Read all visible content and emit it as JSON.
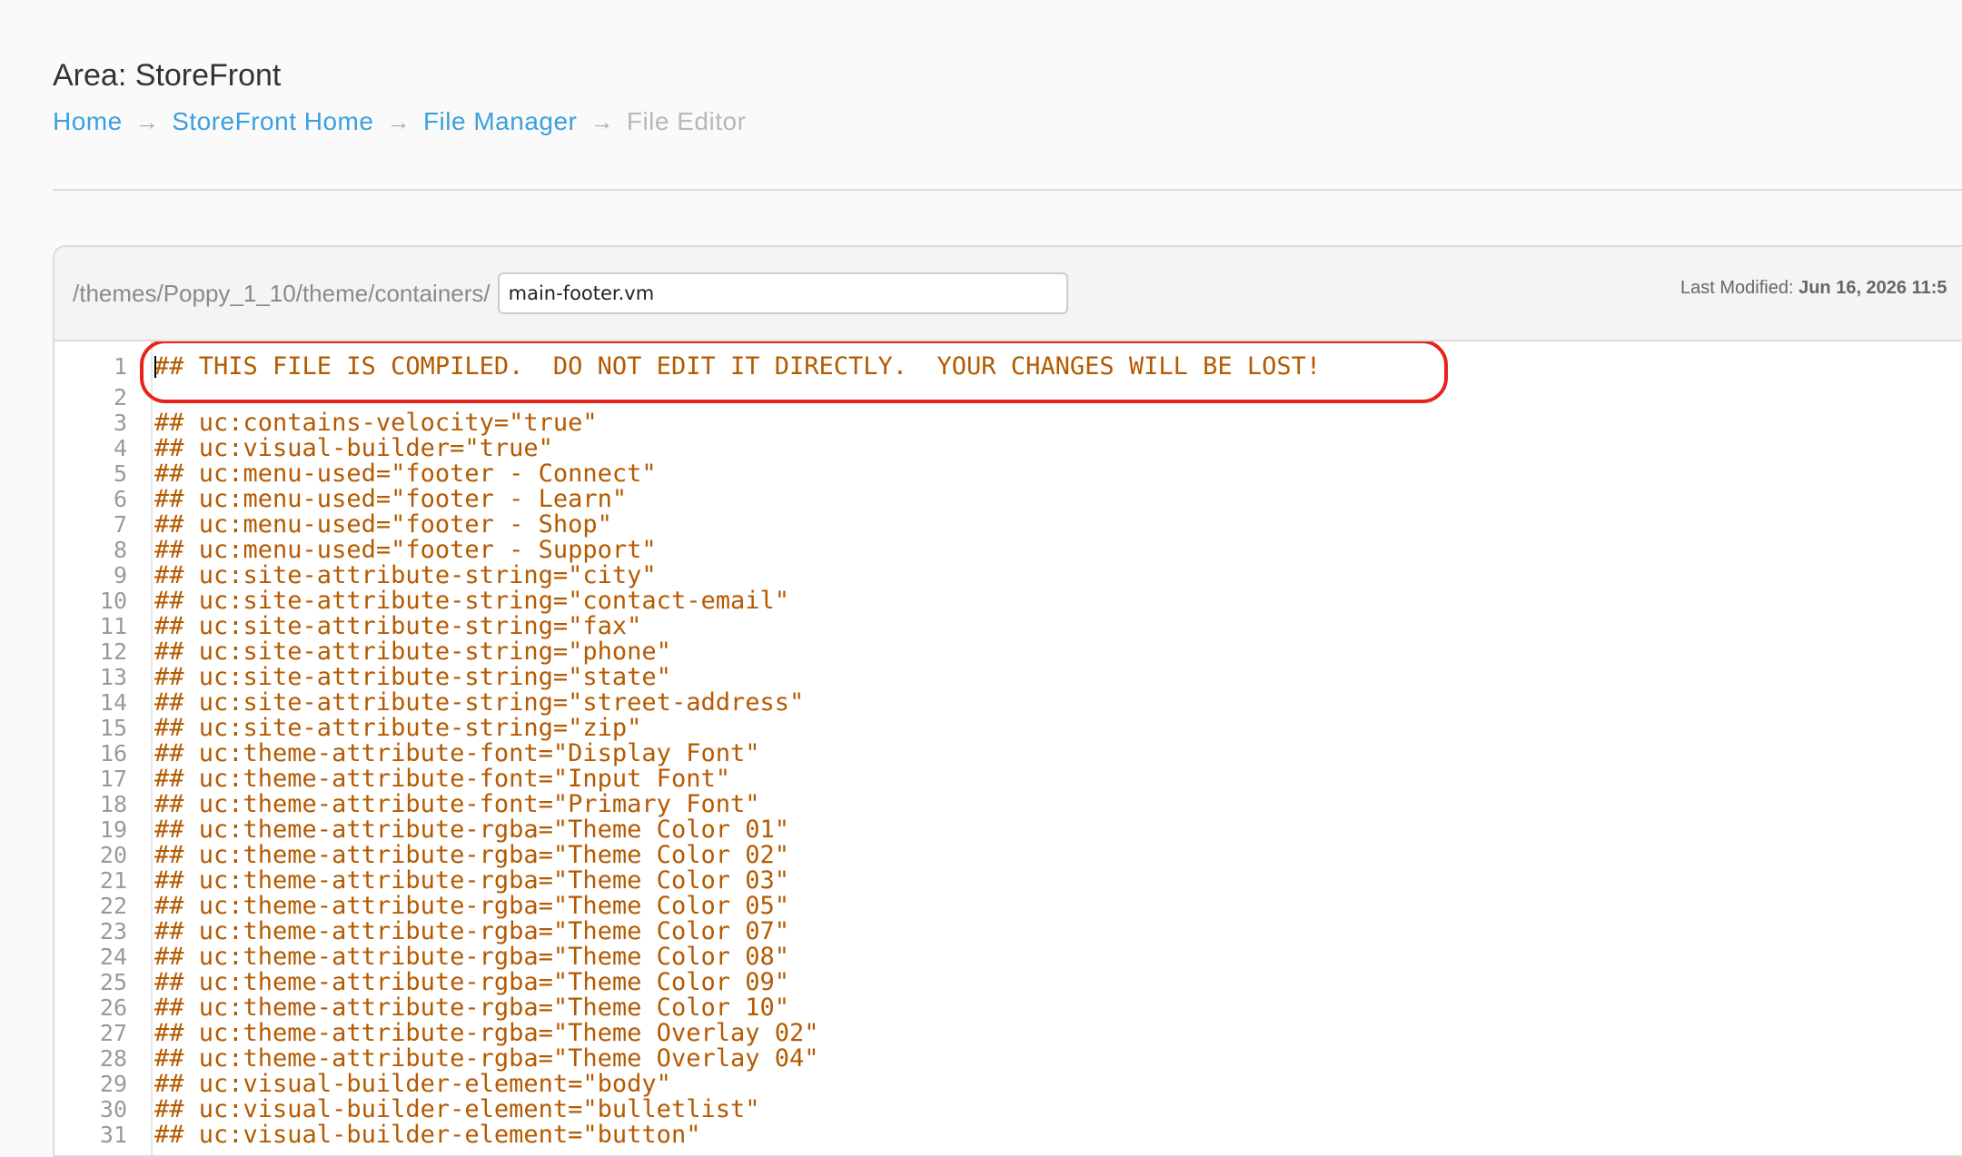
{
  "header": {
    "area_title": "Area: StoreFront",
    "breadcrumb": [
      {
        "label": "Home"
      },
      {
        "label": "StoreFront Home"
      },
      {
        "label": "File Manager"
      }
    ],
    "breadcrumb_current": "File Editor",
    "separator": "→"
  },
  "editor": {
    "path_prefix": "/themes/Poppy_1_10/theme/containers/",
    "filename": "main-footer.vm",
    "last_modified_label": "Last Modified:",
    "last_modified_value": "Jun 16, 2026 11:5",
    "lines": [
      {
        "num": "1",
        "text": "## THIS FILE IS COMPILED.  DO NOT EDIT IT DIRECTLY.  YOUR CHANGES WILL BE LOST!"
      },
      {
        "num": "2",
        "text": ""
      },
      {
        "num": "3",
        "text": "## uc:contains-velocity=\"true\""
      },
      {
        "num": "4",
        "text": "## uc:visual-builder=\"true\""
      },
      {
        "num": "5",
        "text": "## uc:menu-used=\"footer - Connect\""
      },
      {
        "num": "6",
        "text": "## uc:menu-used=\"footer - Learn\""
      },
      {
        "num": "7",
        "text": "## uc:menu-used=\"footer - Shop\""
      },
      {
        "num": "8",
        "text": "## uc:menu-used=\"footer - Support\""
      },
      {
        "num": "9",
        "text": "## uc:site-attribute-string=\"city\""
      },
      {
        "num": "10",
        "text": "## uc:site-attribute-string=\"contact-email\""
      },
      {
        "num": "11",
        "text": "## uc:site-attribute-string=\"fax\""
      },
      {
        "num": "12",
        "text": "## uc:site-attribute-string=\"phone\""
      },
      {
        "num": "13",
        "text": "## uc:site-attribute-string=\"state\""
      },
      {
        "num": "14",
        "text": "## uc:site-attribute-string=\"street-address\""
      },
      {
        "num": "15",
        "text": "## uc:site-attribute-string=\"zip\""
      },
      {
        "num": "16",
        "text": "## uc:theme-attribute-font=\"Display Font\""
      },
      {
        "num": "17",
        "text": "## uc:theme-attribute-font=\"Input Font\""
      },
      {
        "num": "18",
        "text": "## uc:theme-attribute-font=\"Primary Font\""
      },
      {
        "num": "19",
        "text": "## uc:theme-attribute-rgba=\"Theme Color 01\""
      },
      {
        "num": "20",
        "text": "## uc:theme-attribute-rgba=\"Theme Color 02\""
      },
      {
        "num": "21",
        "text": "## uc:theme-attribute-rgba=\"Theme Color 03\""
      },
      {
        "num": "22",
        "text": "## uc:theme-attribute-rgba=\"Theme Color 05\""
      },
      {
        "num": "23",
        "text": "## uc:theme-attribute-rgba=\"Theme Color 07\""
      },
      {
        "num": "24",
        "text": "## uc:theme-attribute-rgba=\"Theme Color 08\""
      },
      {
        "num": "25",
        "text": "## uc:theme-attribute-rgba=\"Theme Color 09\""
      },
      {
        "num": "26",
        "text": "## uc:theme-attribute-rgba=\"Theme Color 10\""
      },
      {
        "num": "27",
        "text": "## uc:theme-attribute-rgba=\"Theme Overlay 02\""
      },
      {
        "num": "28",
        "text": "## uc:theme-attribute-rgba=\"Theme Overlay 04\""
      },
      {
        "num": "29",
        "text": "## uc:visual-builder-element=\"body\""
      },
      {
        "num": "30",
        "text": "## uc:visual-builder-element=\"bulletlist\""
      },
      {
        "num": "31",
        "text": "## uc:visual-builder-element=\"button\""
      }
    ]
  },
  "colors": {
    "link": "#3aa0e0",
    "code_text": "#b55a00",
    "highlight": "#e8231b"
  }
}
